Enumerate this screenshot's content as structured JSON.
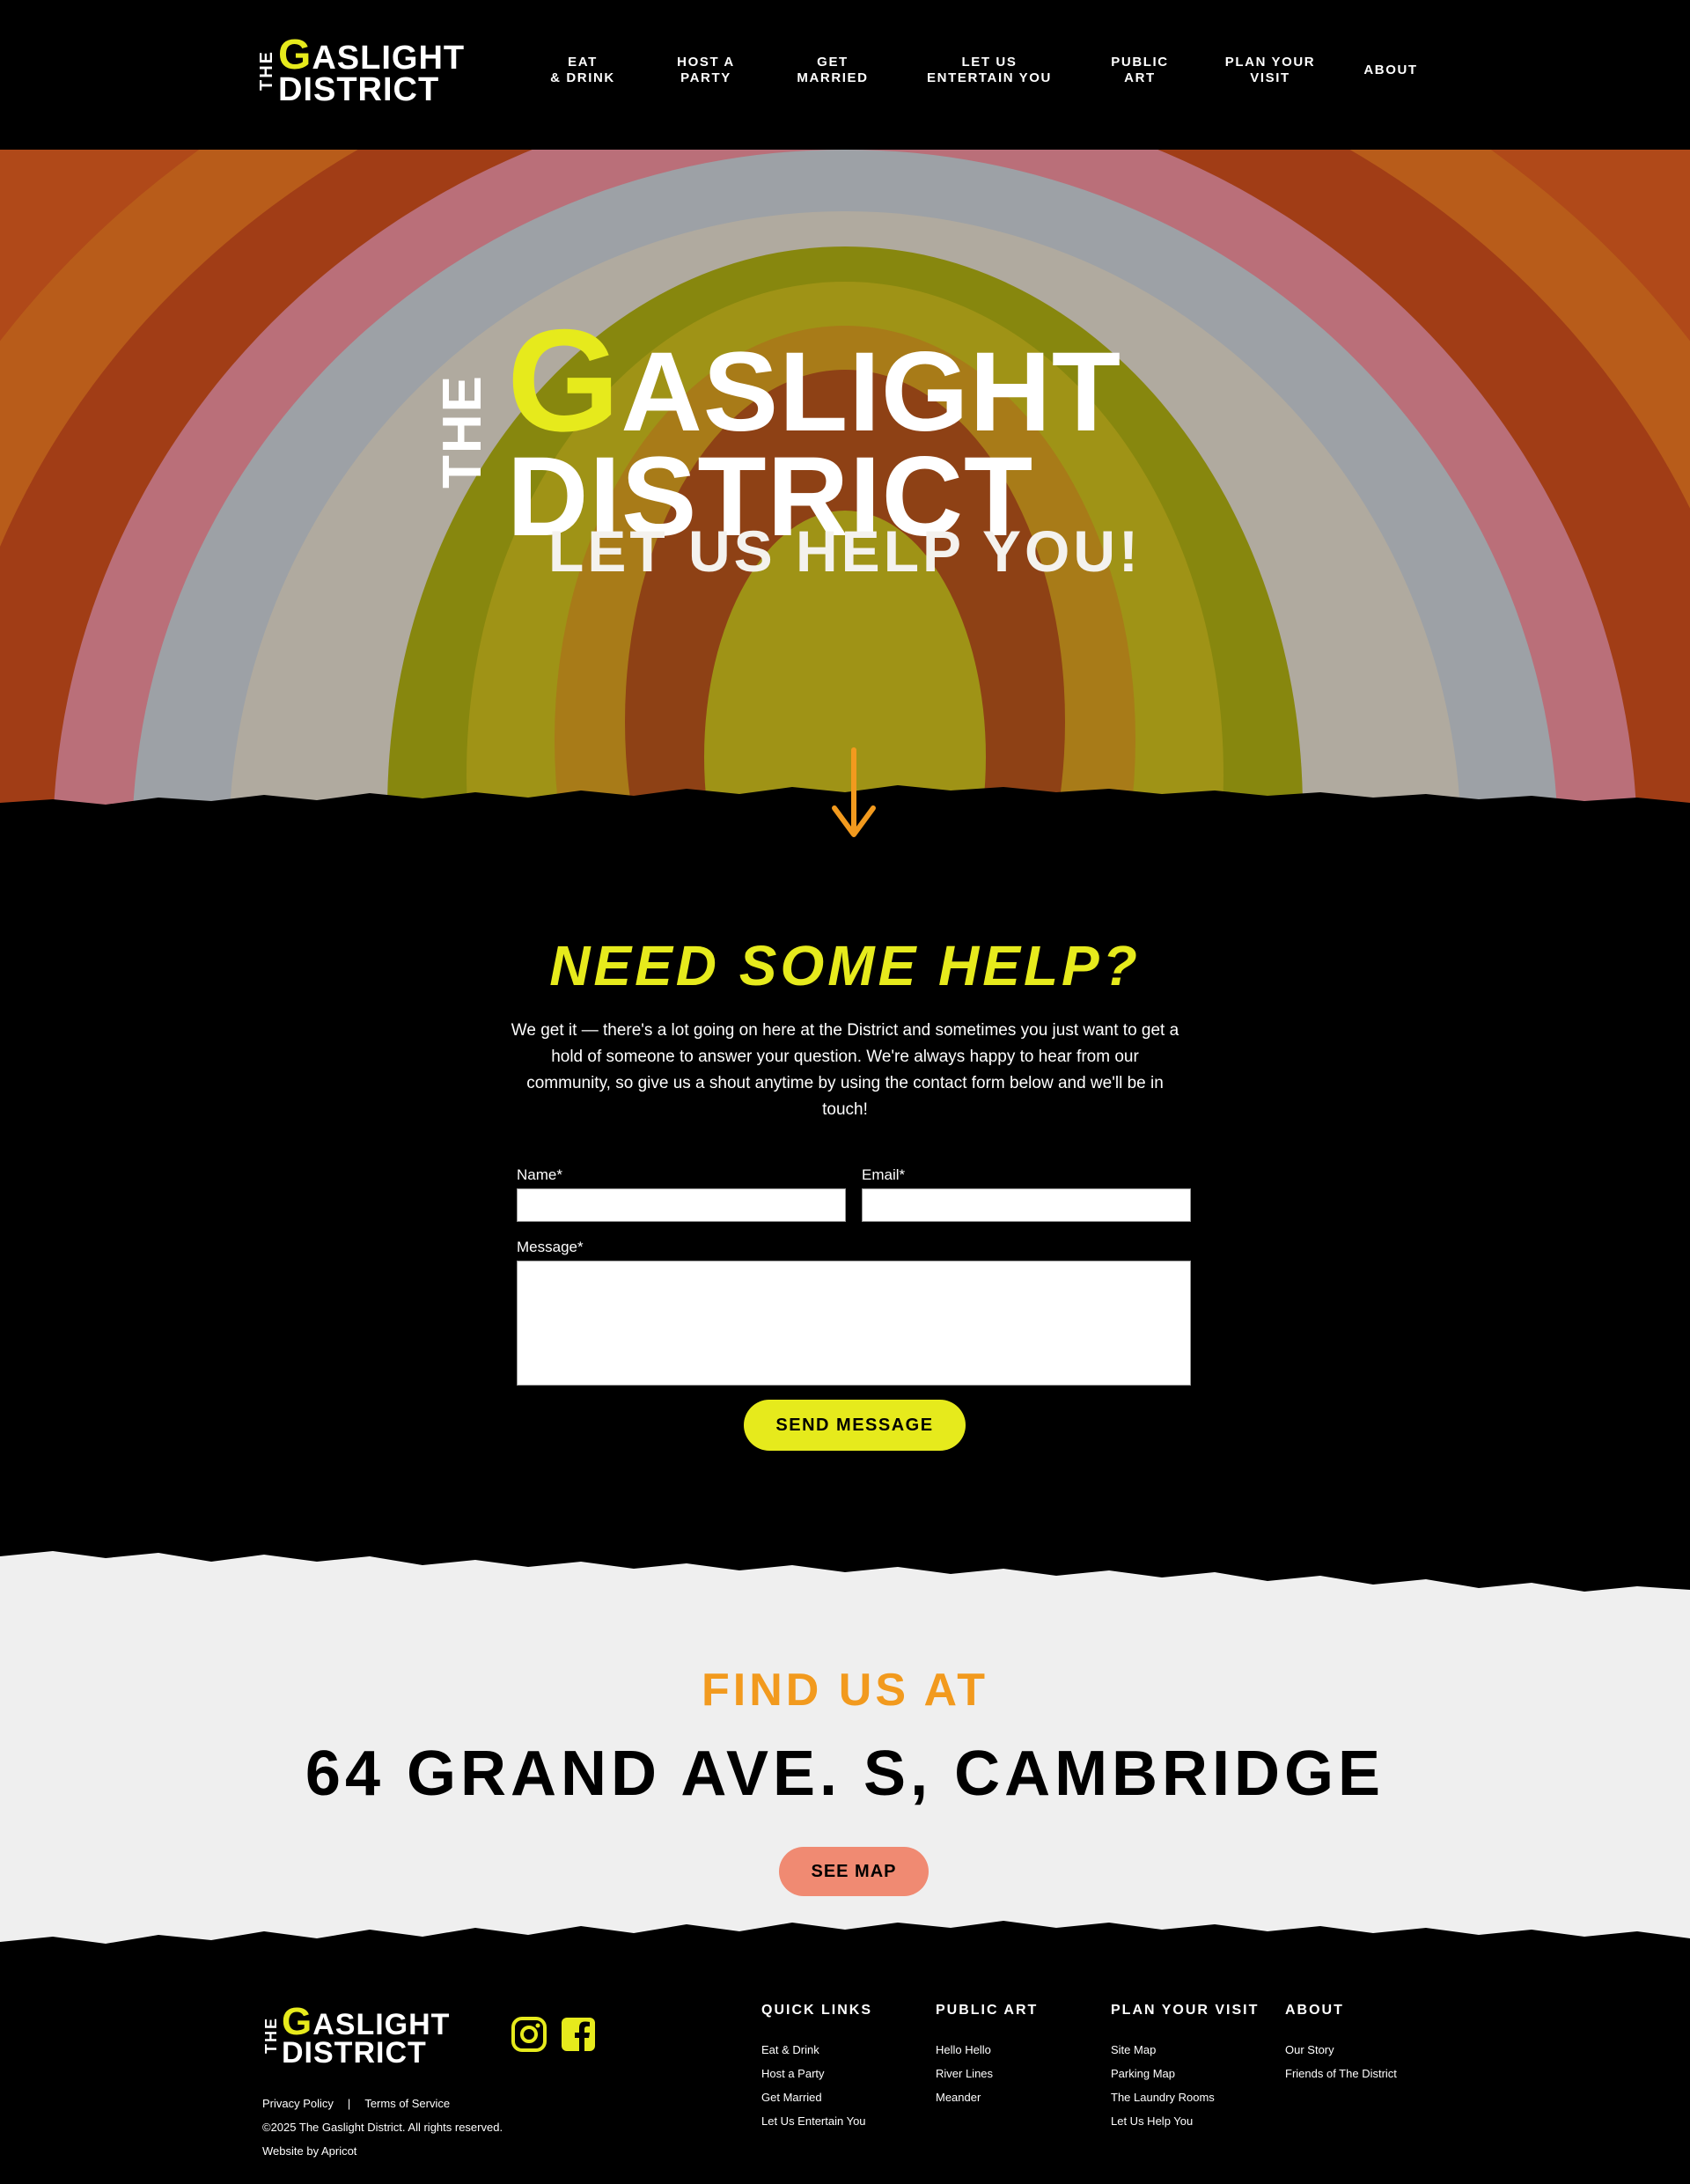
{
  "brand": {
    "the": "THE",
    "g": "G",
    "w1_rest": "ASLIGHT",
    "w2": "DISTRICT"
  },
  "nav": [
    {
      "l1": "EAT",
      "l2": "& DRINK"
    },
    {
      "l1": "HOST A",
      "l2": "PARTY"
    },
    {
      "l1": "GET",
      "l2": "MARRIED"
    },
    {
      "l1": "LET US",
      "l2": "ENTERTAIN YOU"
    },
    {
      "l1": "PUBLIC",
      "l2": "ART"
    },
    {
      "l1": "PLAN YOUR",
      "l2": "VISIT"
    },
    {
      "l1": "ABOUT",
      "l2": ""
    }
  ],
  "hero": {
    "subtitle": "LET US HELP YOU!"
  },
  "help": {
    "title": "NEED SOME HELP?",
    "intro": "We get it — there's a lot going on here at the District and sometimes you just want to get a hold of someone to answer your question. We're always happy to hear from our community, so give us a shout anytime by using the contact form below and we'll be in touch!",
    "name_label": "Name*",
    "email_label": "Email*",
    "message_label": "Message*",
    "name_value": "",
    "email_value": "",
    "message_value": "",
    "send_label": "SEND MESSAGE"
  },
  "find": {
    "title": "FIND US AT",
    "address": "64 GRAND AVE. S, CAMBRIDGE",
    "map_label": "SEE MAP"
  },
  "footer": {
    "legal": {
      "privacy": "Privacy Policy",
      "sep": "|",
      "terms": "Terms of Service",
      "copyright": "©2025 The Gaslight District. All rights reserved.",
      "credit": "Website by Apricot"
    },
    "columns": [
      {
        "title": "QUICK LINKS",
        "links": [
          "Eat & Drink",
          "Host a Party",
          "Get Married",
          "Let Us Entertain You"
        ]
      },
      {
        "title": "PUBLIC ART",
        "links": [
          "Hello Hello",
          "River Lines",
          "Meander"
        ]
      },
      {
        "title": "PLAN YOUR VISIT",
        "links": [
          "Site Map",
          "Parking Map",
          "The Laundry Rooms",
          "Let Us Help You"
        ]
      },
      {
        "title": "ABOUT",
        "links": [
          "Our Story",
          "Friends of The District"
        ]
      }
    ]
  },
  "colors": {
    "accent_yellow": "#e6ea1c",
    "accent_orange": "#f29a1e",
    "map_button": "#f08a72",
    "background": "#000000",
    "find_bg": "#efefef"
  },
  "icons": {
    "arrow": "arrow-down-icon",
    "instagram": "instagram-icon",
    "facebook": "facebook-icon"
  }
}
